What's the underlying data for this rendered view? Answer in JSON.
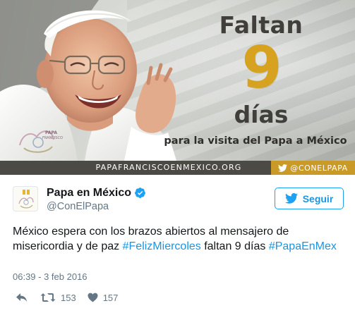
{
  "banner": {
    "logo_text_line1": "PAPA",
    "logo_text_line2": "FRANCISCO",
    "headline_top": "Faltan",
    "days_count": "9",
    "headline_unit": "días",
    "subline": "para la visita del Papa a México",
    "footer_url": "PAPAFRANCISCOENMEXICO.ORG",
    "footer_handle": "@CONELPAPA",
    "colors": {
      "accent_gold": "#d6a21f",
      "footer_gray": "#4b4a44",
      "headline_text": "#403f3b"
    }
  },
  "tweet": {
    "display_name": "Papa en México",
    "handle": "@ConElPapa",
    "verified_icon": "verified-badge-icon",
    "follow_label": "Seguir",
    "text_part1": "México espera con los brazos abiertos al mensajero de misericordia y de paz ",
    "hashtag1": "#FelizMiercoles",
    "text_part2": " faltan 9 días ",
    "hashtag2": "#PapaEnMex",
    "timestamp": "06:39 - 3 feb 2016",
    "retweet_count": "153",
    "like_count": "157",
    "colors": {
      "link_blue": "#1b95e0",
      "meta_gray": "#657786"
    }
  }
}
